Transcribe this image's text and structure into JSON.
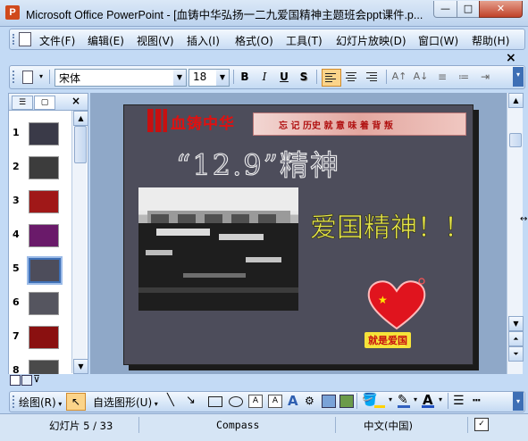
{
  "window": {
    "title": "Microsoft Office PowerPoint - [血铸中华弘扬一二九爱国精神主题班会ppt课件.p...",
    "app_icon": "P",
    "minimize": "—",
    "maximize": "□",
    "close": "✕"
  },
  "menu": {
    "items": [
      "文件(F)",
      "编辑(E)",
      "视图(V)",
      "插入(I)",
      "格式(O)",
      "工具(T)",
      "幻灯片放映(D)",
      "窗口(W)",
      "帮助(H)"
    ],
    "close_doc": "×"
  },
  "toolbar": {
    "font_name": "宋体",
    "font_size": "18",
    "bold": "B",
    "italic": "I",
    "underline": "U",
    "shadow": "S"
  },
  "panel": {
    "tab_outline": "☰",
    "tab_slides": "▢",
    "close": "×",
    "slides": [
      {
        "num": "1",
        "color": "#3a3a48"
      },
      {
        "num": "2",
        "color": "#3c3c3c"
      },
      {
        "num": "3",
        "color": "#a01818"
      },
      {
        "num": "4",
        "color": "#6a1a6a"
      },
      {
        "num": "5",
        "color": "#4d4d5b"
      },
      {
        "num": "6",
        "color": "#55555f"
      },
      {
        "num": "7",
        "color": "#8a1010"
      },
      {
        "num": "8",
        "color": "#4a4a4a"
      }
    ],
    "selected_slide": "5"
  },
  "slide": {
    "logo_text": "血铸中华",
    "banner_text": "忘 记  历史  就 意 味 着 背 叛",
    "title": "“12.9”精神",
    "subtitle": "爱国精神！！！",
    "heart_caption": "就是爱国",
    "colors": {
      "background": "#4d4d5b",
      "subtitle": "#e6e64a",
      "heart": "#e0141e"
    }
  },
  "drawing": {
    "draw_menu": "绘图(R)",
    "autoshapes_menu": "自选图形(U)"
  },
  "status": {
    "slide_indicator": "幻灯片 5 / 33",
    "design": "Compass",
    "language": "中文(中国)"
  }
}
